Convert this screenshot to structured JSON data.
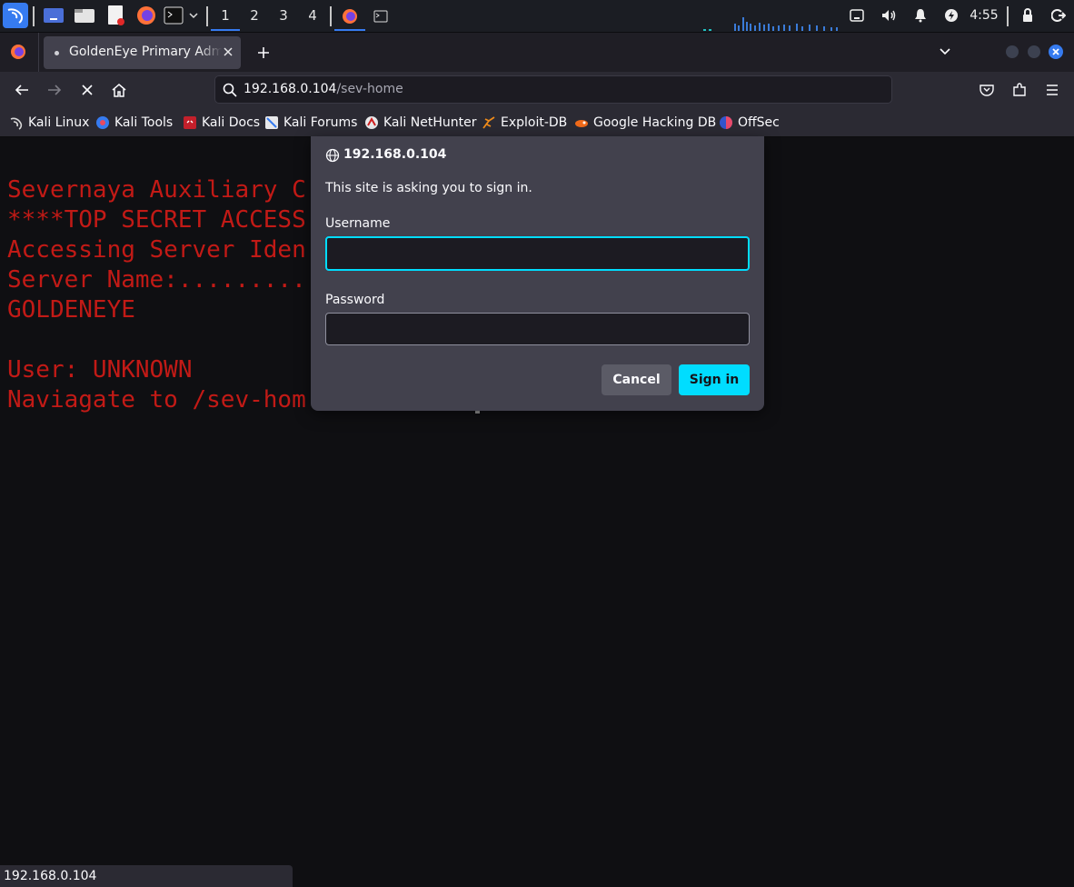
{
  "panel": {
    "workspaces": [
      "1",
      "2",
      "3",
      "4"
    ],
    "active_workspace": "1",
    "clock": "4:55"
  },
  "tab": {
    "title": "GoldenEye Primary Admin Server"
  },
  "url": {
    "host": "192.168.0.104",
    "path": "/sev-home"
  },
  "bookmarks": [
    {
      "label": "Kali Linux",
      "icon": "kali-dragon-icon"
    },
    {
      "label": "Kali Tools",
      "icon": "kali-tools-icon"
    },
    {
      "label": "Kali Docs",
      "icon": "kali-docs-icon"
    },
    {
      "label": "Kali Forums",
      "icon": "kali-forums-icon"
    },
    {
      "label": "Kali NetHunter",
      "icon": "nethunter-icon"
    },
    {
      "label": "Exploit-DB",
      "icon": "exploit-db-icon"
    },
    {
      "label": "Google Hacking DB",
      "icon": "ghdb-icon"
    },
    {
      "label": "OffSec",
      "icon": "offsec-icon"
    }
  ],
  "page": {
    "lines": [
      "Severnaya Auxiliary C",
      "****TOP SECRET ACCESS",
      "Accessing Server Iden",
      "Server Name:.........",
      "GOLDENEYE",
      "",
      "User: UNKNOWN",
      "Naviagate to /sev-hom"
    ]
  },
  "dialog": {
    "host": "192.168.0.104",
    "message": "This site is asking you to sign in.",
    "username_label": "Username",
    "username_value": "",
    "password_label": "Password",
    "password_value": "",
    "cancel_label": "Cancel",
    "signin_label": "Sign in"
  },
  "status": {
    "text": "192.168.0.104"
  },
  "colors": {
    "terminal_text": "#c21a16",
    "accent": "#00ddff",
    "kali_blue": "#367bf0"
  }
}
